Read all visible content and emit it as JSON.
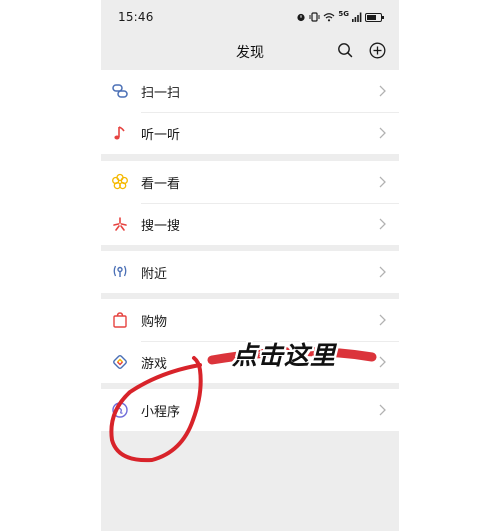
{
  "status": {
    "time": "15:46",
    "network": "5G"
  },
  "header": {
    "title": "发现"
  },
  "menu": {
    "scan": "扫一扫",
    "listen": "听一听",
    "look": "看一看",
    "search": "搜一搜",
    "nearby": "附近",
    "shopping": "购物",
    "games": "游戏",
    "miniprogram": "小程序"
  },
  "annotation": {
    "text": "点击这里",
    "color": "#d8232a"
  },
  "colors": {
    "background": "#ededed",
    "accent_red": "#e64340",
    "accent_blue": "#4a6fb5",
    "accent_yellow": "#f5b800"
  }
}
